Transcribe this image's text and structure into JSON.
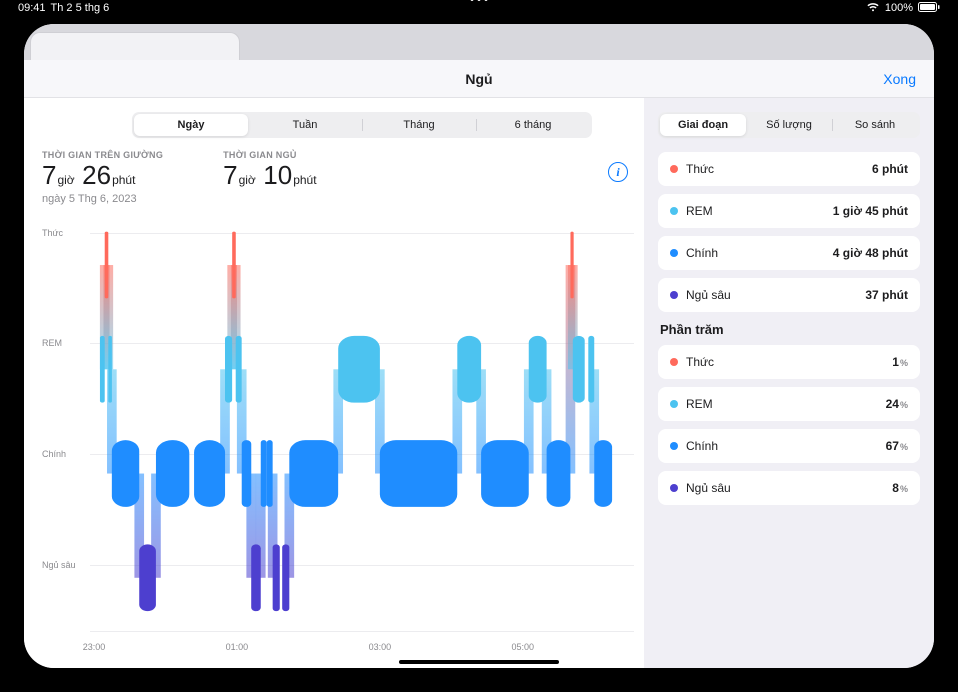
{
  "status": {
    "time": "09:41",
    "date": "Th 2 5 thg 6",
    "battery": "100%"
  },
  "header": {
    "title": "Ngủ",
    "done": "Xong"
  },
  "period_seg": [
    "Ngày",
    "Tuần",
    "Tháng",
    "6 tháng"
  ],
  "period_selected": 0,
  "view_seg": [
    "Giai đoạn",
    "Số lượng",
    "So sánh"
  ],
  "view_selected": 0,
  "summary": {
    "bed": {
      "caption": "THỜI GIAN TRÊN GIƯỜNG",
      "h_num": "7",
      "h_unit": "giờ",
      "m_num": "26",
      "m_unit": "phút",
      "sub": "ngày 5 Thg 6, 2023"
    },
    "asleep": {
      "caption": "THỜI GIAN NGỦ",
      "h_num": "7",
      "h_unit": "giờ",
      "m_num": "10",
      "m_unit": "phút"
    }
  },
  "legend": {
    "stages": [
      {
        "color": "wake",
        "label": "Thức",
        "value": "6 phút"
      },
      {
        "color": "rem",
        "label": "REM",
        "value": "1 giờ 45 phút"
      },
      {
        "color": "core",
        "label": "Chính",
        "value": "4 giờ 48 phút"
      },
      {
        "color": "deep",
        "label": "Ngủ sâu",
        "value": "37 phút"
      }
    ],
    "percent_title": "Phần trăm",
    "percents": [
      {
        "color": "wake",
        "label": "Thức",
        "value": "1",
        "unit": "%"
      },
      {
        "color": "rem",
        "label": "REM",
        "value": "24",
        "unit": "%"
      },
      {
        "color": "core",
        "label": "Chính",
        "value": "67",
        "unit": "%"
      },
      {
        "color": "deep",
        "label": "Ngủ sâu",
        "value": "8",
        "unit": "%"
      }
    ]
  },
  "chart_data": {
    "type": "hypnogram",
    "x_start": "23:00",
    "x_end": "06:30",
    "x_ticks": [
      "23:00",
      "01:00",
      "03:00",
      "05:00"
    ],
    "y_stages": [
      "Thức",
      "REM",
      "Chính",
      "Ngủ sâu"
    ],
    "stage_colors": {
      "Thức": "#ff6a5c",
      "REM": "#4cc3f0",
      "Chính": "#1f8dff",
      "Ngủ sâu": "#4d3fcf"
    },
    "segments": [
      {
        "stage": "REM",
        "start": "23:05",
        "end": "23:09"
      },
      {
        "stage": "Thức",
        "start": "23:09",
        "end": "23:12"
      },
      {
        "stage": "REM",
        "start": "23:12",
        "end": "23:15"
      },
      {
        "stage": "Chính",
        "start": "23:15",
        "end": "23:38"
      },
      {
        "stage": "Ngủ sâu",
        "start": "23:38",
        "end": "23:52"
      },
      {
        "stage": "Chính",
        "start": "23:52",
        "end": "00:20"
      },
      {
        "stage": "Chính",
        "start": "00:24",
        "end": "00:50"
      },
      {
        "stage": "REM",
        "start": "00:50",
        "end": "00:56"
      },
      {
        "stage": "Thức",
        "start": "00:56",
        "end": "00:59"
      },
      {
        "stage": "REM",
        "start": "00:59",
        "end": "01:04"
      },
      {
        "stage": "Chính",
        "start": "01:04",
        "end": "01:12"
      },
      {
        "stage": "Ngủ sâu",
        "start": "01:12",
        "end": "01:20"
      },
      {
        "stage": "Chính",
        "start": "01:20",
        "end": "01:25"
      },
      {
        "stage": "Chính",
        "start": "01:25",
        "end": "01:30"
      },
      {
        "stage": "Ngủ sâu",
        "start": "01:30",
        "end": "01:36"
      },
      {
        "stage": "Ngủ sâu",
        "start": "01:38",
        "end": "01:44"
      },
      {
        "stage": "Chính",
        "start": "01:44",
        "end": "02:25"
      },
      {
        "stage": "REM",
        "start": "02:25",
        "end": "03:00"
      },
      {
        "stage": "Chính",
        "start": "03:00",
        "end": "04:05"
      },
      {
        "stage": "REM",
        "start": "04:05",
        "end": "04:25"
      },
      {
        "stage": "Chính",
        "start": "04:25",
        "end": "05:05"
      },
      {
        "stage": "REM",
        "start": "05:05",
        "end": "05:20"
      },
      {
        "stage": "Chính",
        "start": "05:20",
        "end": "05:40"
      },
      {
        "stage": "Thức",
        "start": "05:40",
        "end": "05:42"
      },
      {
        "stage": "REM",
        "start": "05:42",
        "end": "05:52"
      },
      {
        "stage": "REM",
        "start": "05:55",
        "end": "06:00"
      },
      {
        "stage": "Chính",
        "start": "06:00",
        "end": "06:15"
      }
    ]
  }
}
